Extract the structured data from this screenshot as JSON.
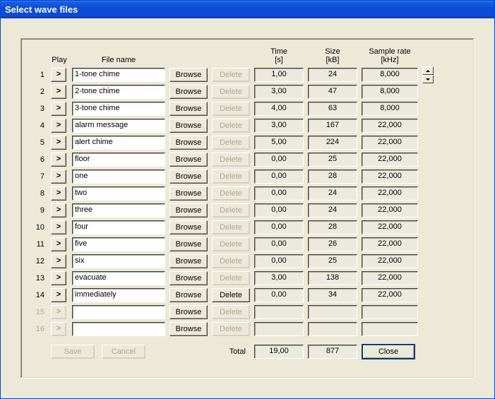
{
  "window": {
    "title": "Select wave files"
  },
  "headers": {
    "play": "Play",
    "file_name": "File name",
    "time_l1": "Time",
    "time_l2": "[s]",
    "size_l1": "Size",
    "size_l2": "[kB]",
    "rate_l1": "Sample rate",
    "rate_l2": "[kHz]"
  },
  "labels": {
    "play_glyph": ">",
    "browse": "Browse",
    "delete": "Delete",
    "save": "Save",
    "cancel": "Cancel",
    "close": "Close",
    "total": "Total"
  },
  "rows": [
    {
      "num": "1",
      "name": "1-tone chime",
      "time": "1,00",
      "size": "24",
      "rate": "8,000",
      "play_en": true,
      "del_en": false
    },
    {
      "num": "2",
      "name": "2-tone chime",
      "time": "3,00",
      "size": "47",
      "rate": "8,000",
      "play_en": true,
      "del_en": false
    },
    {
      "num": "3",
      "name": "3-tone chime",
      "time": "4,00",
      "size": "63",
      "rate": "8,000",
      "play_en": true,
      "del_en": false
    },
    {
      "num": "4",
      "name": "alarm message",
      "time": "3,00",
      "size": "167",
      "rate": "22,000",
      "play_en": true,
      "del_en": false
    },
    {
      "num": "5",
      "name": "alert chime",
      "time": "5,00",
      "size": "224",
      "rate": "22,000",
      "play_en": true,
      "del_en": false
    },
    {
      "num": "6",
      "name": "floor",
      "time": "0,00",
      "size": "25",
      "rate": "22,000",
      "play_en": true,
      "del_en": false
    },
    {
      "num": "7",
      "name": "one",
      "time": "0,00",
      "size": "28",
      "rate": "22,000",
      "play_en": true,
      "del_en": false
    },
    {
      "num": "8",
      "name": "two",
      "time": "0,00",
      "size": "24",
      "rate": "22,000",
      "play_en": true,
      "del_en": false
    },
    {
      "num": "9",
      "name": "three",
      "time": "0,00",
      "size": "24",
      "rate": "22,000",
      "play_en": true,
      "del_en": false
    },
    {
      "num": "10",
      "name": "four",
      "time": "0,00",
      "size": "28",
      "rate": "22,000",
      "play_en": true,
      "del_en": false
    },
    {
      "num": "11",
      "name": "five",
      "time": "0,00",
      "size": "26",
      "rate": "22,000",
      "play_en": true,
      "del_en": false
    },
    {
      "num": "12",
      "name": "six",
      "time": "0,00",
      "size": "25",
      "rate": "22,000",
      "play_en": true,
      "del_en": false
    },
    {
      "num": "13",
      "name": "evacuate",
      "time": "3,00",
      "size": "138",
      "rate": "22,000",
      "play_en": true,
      "del_en": false
    },
    {
      "num": "14",
      "name": "immediately",
      "time": "0,00",
      "size": "34",
      "rate": "22,000",
      "play_en": true,
      "del_en": true
    },
    {
      "num": "15",
      "name": "",
      "time": "",
      "size": "",
      "rate": "",
      "play_en": false,
      "del_en": false,
      "num_disabled": true
    },
    {
      "num": "16",
      "name": "",
      "time": "",
      "size": "",
      "rate": "",
      "play_en": false,
      "del_en": false,
      "num_disabled": true
    }
  ],
  "totals": {
    "time": "19,00",
    "size": "877"
  },
  "footer_buttons": {
    "save_en": false,
    "cancel_en": false,
    "close_en": true
  }
}
